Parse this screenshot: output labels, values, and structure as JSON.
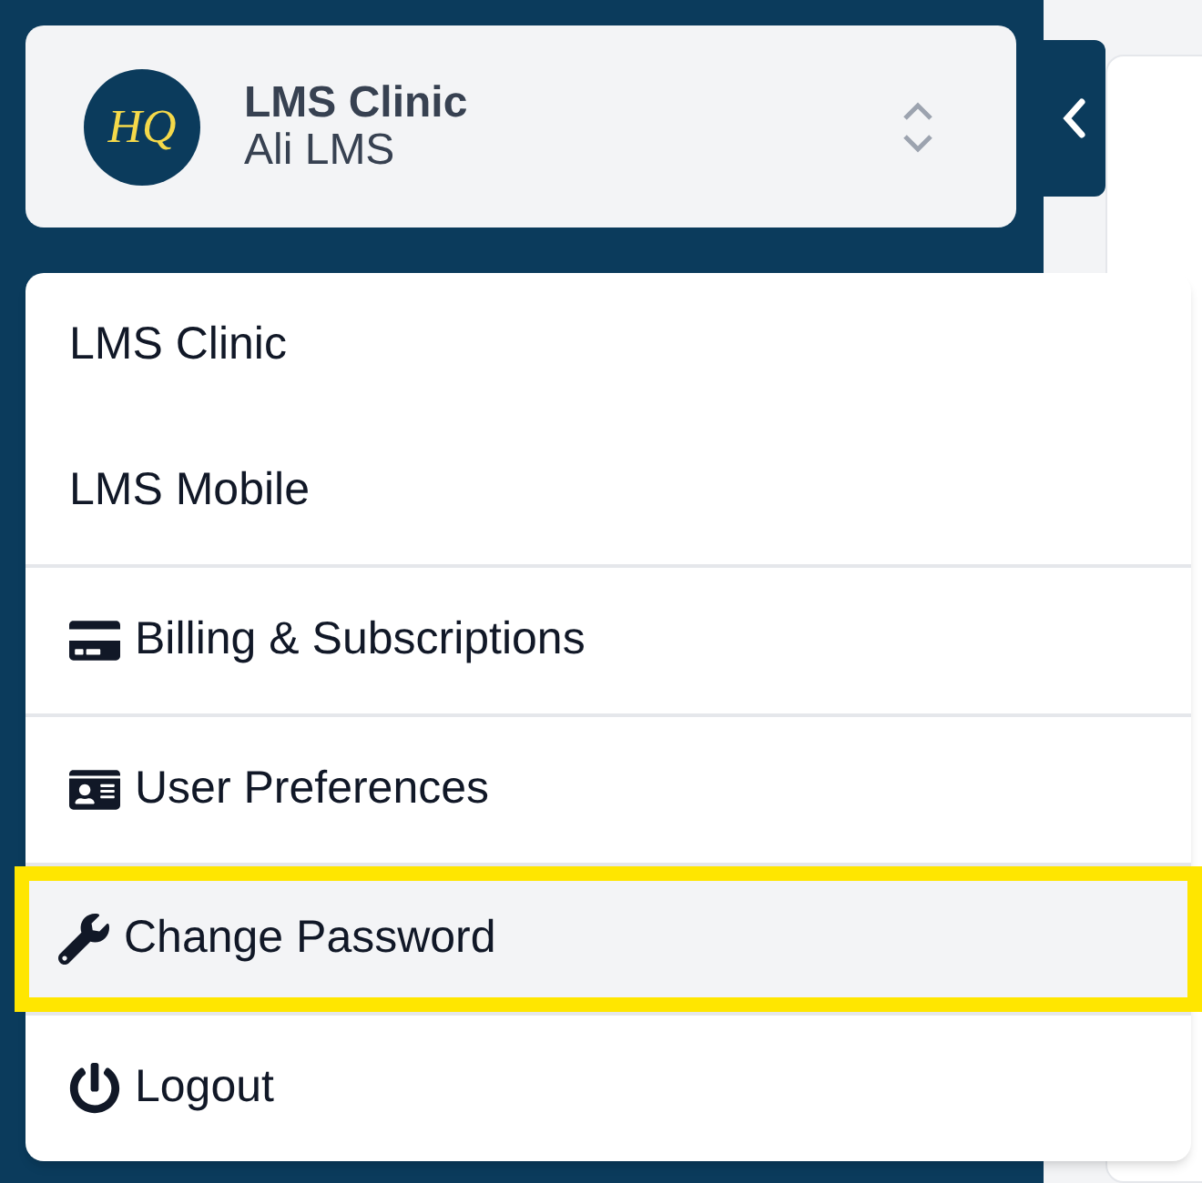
{
  "account": {
    "logo": "HQ",
    "name": "LMS Clinic",
    "user": "Ali LMS"
  },
  "menu": {
    "sections": [
      {
        "items": [
          {
            "label": "LMS Clinic",
            "highlighted": false
          },
          {
            "label": "LMS Mobile",
            "highlighted": false
          }
        ]
      },
      {
        "items": [
          {
            "label": "Billing & Subscriptions",
            "highlighted": false
          }
        ]
      },
      {
        "items": [
          {
            "label": "User Preferences",
            "highlighted": false
          }
        ]
      },
      {
        "items": [
          {
            "label": "Change Password",
            "highlighted": true
          }
        ]
      },
      {
        "items": [
          {
            "label": "Logout",
            "highlighted": false
          }
        ]
      }
    ]
  }
}
